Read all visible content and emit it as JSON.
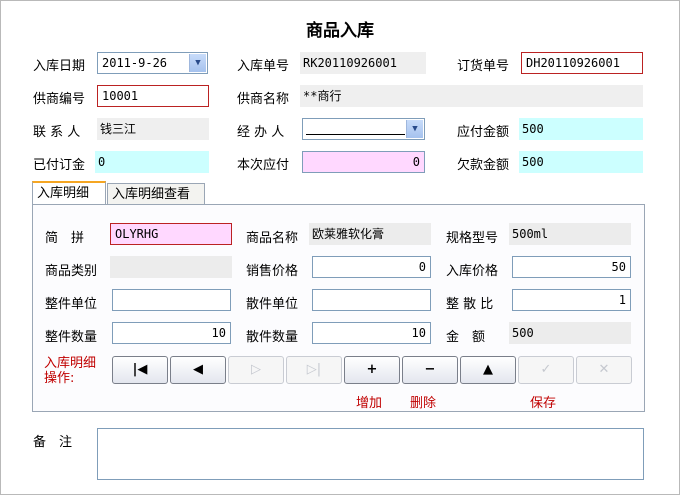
{
  "title": "商品入库",
  "header": {
    "in_date_label": "入库日期",
    "in_date_value": "2011-9-26",
    "in_no_label": "入库单号",
    "in_no_value": "RK20110926001",
    "order_no_label": "订货单号",
    "order_no_value": "DH20110926001",
    "supplier_no_label": "供商编号",
    "supplier_no_value": "10001",
    "supplier_name_label": "供商名称",
    "supplier_name_value": "**商行",
    "contact_label": "联 系 人",
    "contact_value": "钱三江",
    "handler_label": "经 办 人",
    "handler_value": "",
    "payable_total_label": "应付金额",
    "payable_total_value": "500",
    "paid_deposit_label": "已付订金",
    "paid_deposit_value": "0",
    "current_pay_label": "本次应付",
    "current_pay_value": "0",
    "owed_label": "欠款金额",
    "owed_value": "500"
  },
  "tabs": [
    {
      "label": "入库明细"
    },
    {
      "label": "入库明细查看"
    }
  ],
  "detail": {
    "pinyin_label": "简　拼",
    "pinyin_value": "OLYRHG",
    "name_label": "商品名称",
    "name_value": "欧莱雅软化膏",
    "spec_label": "规格型号",
    "spec_value": "500ml",
    "category_label": "商品类别",
    "category_value": "",
    "sale_price_label": "销售价格",
    "sale_price_value": "0",
    "in_price_label": "入库价格",
    "in_price_value": "50",
    "whole_unit_label": "整件单位",
    "whole_unit_value": "",
    "piece_unit_label": "散件单位",
    "piece_unit_value": "",
    "ratio_label": "整 散 比",
    "ratio_value": "1",
    "whole_qty_label": "整件数量",
    "whole_qty_value": "10",
    "piece_qty_label": "散件数量",
    "piece_qty_value": "10",
    "amount_label": "金　额",
    "amount_value": "500",
    "ops_label_line1": "入库明细",
    "ops_label_line2": "操作:"
  },
  "toolbar": {
    "first_symbol": "|◀",
    "prev_symbol": "◀",
    "next_symbol": "▷",
    "last_symbol": "▷|",
    "add_symbol": "+",
    "delete_symbol": "−",
    "up_symbol": "▲",
    "save_symbol": "✓",
    "cancel_symbol": "✕",
    "add_label": "增加",
    "delete_label": "删除",
    "save_label": "保存"
  },
  "memo": {
    "label": "备　注",
    "value": ""
  },
  "colors": {
    "readonly_cyan": "#ccffff",
    "readonly_grey": "#efefef",
    "pink_field": "#ffd8ff",
    "required_border": "#b22222",
    "action_text": "#c00000"
  }
}
